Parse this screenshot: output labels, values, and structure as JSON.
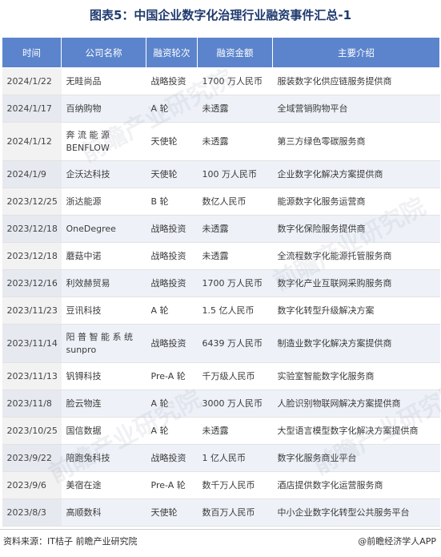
{
  "title": "图表5：中国企业数字化治理行业融资事件汇总-1",
  "columns": [
    "时间",
    "公司名称",
    "融资轮次",
    "融资金额",
    "主要介绍"
  ],
  "rows": [
    [
      "2024/1/22",
      "无畦尚品",
      "战略投资",
      "1700 万人民币",
      "服装数字化供应链服务提供商"
    ],
    [
      "2024/1/17",
      "百纳购物",
      "A 轮",
      "未透露",
      "全域营销购物平台"
    ],
    [
      "2024/1/12",
      "奔 流 能 源 BENFLOW",
      "天使轮",
      "未透露",
      "第三方绿色零碳服务商"
    ],
    [
      "2024/1/9",
      "企沃达科技",
      "天使轮",
      "100 万人民币",
      "企业数字化解决方案提供商"
    ],
    [
      "2023/12/25",
      "浙达能源",
      "B 轮",
      "数亿人民币",
      "能源数字化服务运营商"
    ],
    [
      "2023/12/18",
      "OneDegree",
      "战略投资",
      "未透露",
      "数字化保险服务提供商"
    ],
    [
      "2023/12/18",
      "蘑菇中诺",
      "战略投资",
      "未透露",
      "全流程数字化能源托管服务商"
    ],
    [
      "2023/12/16",
      "利效赫贸易",
      "战略投资",
      "1700 万人民币",
      "数字化产业互联网采购服务商"
    ],
    [
      "2023/11/23",
      "豆讯科技",
      "A 轮",
      "1.5 亿人民币",
      "数字化转型升级解决方案"
    ],
    [
      "2023/11/14",
      "阳 普 智 能 系 统 sunpro",
      "战略投资",
      "6439 万人民币",
      "制造业数字化解决方案提供商"
    ],
    [
      "2023/11/13",
      "钒锝科技",
      "Pre-A 轮",
      "千万级人民币",
      "实验室智能数字化服务商"
    ],
    [
      "2023/11/8",
      "脸云物连",
      "A 轮",
      "3000 万人民币",
      "人脸识别物联网解决方案提供商"
    ],
    [
      "2023/10/25",
      "国信数据",
      "A 轮",
      "未透露",
      "大型语言模型数字化解决方案提供商"
    ],
    [
      "2023/9/22",
      "陪跑兔科技",
      "战略投资",
      "1 亿人民币",
      "数字化服务商业平台"
    ],
    [
      "2023/9/6",
      "美宿在途",
      "Pre-A 轮",
      "数千万人民币",
      "酒店提供数字化运营服务商"
    ],
    [
      "2023/8/3",
      "高顺数科",
      "天使轮",
      "数百万人民币",
      "中小企业数字化转型公共服务平台"
    ]
  ],
  "watermark": "前瞻产业研究院",
  "footer": {
    "source": "资料来源：IT桔子 前瞻产业研究院",
    "brand": "@前瞻经济学人APP"
  }
}
